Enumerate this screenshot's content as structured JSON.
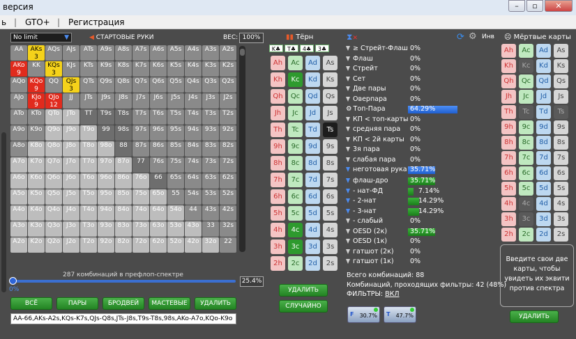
{
  "title": "версия",
  "window_buttons": [
    "–",
    "▫",
    "✕"
  ],
  "menu": [
    "ь",
    "GTO+",
    "Регистрация"
  ],
  "left": {
    "mode": "No limit",
    "start_hands": "СТАРТОВЫЕ РУКИ",
    "weight_label": "ВЕС:",
    "weight": "100%",
    "combos": "287 комбинаций в префлоп-спектре",
    "slider_min": "0%",
    "slider_val": "25.4%",
    "buttons": [
      "ВСЁ",
      "ПАРЫ",
      "БРОДВЕЙ",
      "МАСТЕВЫЕ",
      "УДАЛИТЬ"
    ],
    "range_text": "AA-66,AKs-A2s,KQs-K7s,QJs-Q8s,JTs-J8s,T9s-T8s,98s,AKo-A7o,KQo-K9o",
    "grid": [
      [
        [
          "AA",
          ""
        ],
        [
          "AKs",
          "3"
        ],
        [
          "AQs",
          ""
        ],
        [
          "AJs",
          ""
        ],
        [
          "ATs",
          ""
        ],
        [
          "A9s",
          ""
        ],
        [
          "A8s",
          ""
        ],
        [
          "A7s",
          ""
        ],
        [
          "A6s",
          ""
        ],
        [
          "A5s",
          ""
        ],
        [
          "A4s",
          ""
        ],
        [
          "A3s",
          ""
        ],
        [
          "A2s",
          ""
        ]
      ],
      [
        [
          "AKo",
          "9"
        ],
        [
          "KK",
          ""
        ],
        [
          "KQs",
          "3"
        ],
        [
          "KJs",
          ""
        ],
        [
          "KTs",
          ""
        ],
        [
          "K9s",
          ""
        ],
        [
          "K8s",
          ""
        ],
        [
          "K7s",
          ""
        ],
        [
          "K6s",
          ""
        ],
        [
          "K5s",
          ""
        ],
        [
          "K4s",
          ""
        ],
        [
          "K3s",
          ""
        ],
        [
          "K2s",
          ""
        ]
      ],
      [
        [
          "AQo",
          ""
        ],
        [
          "KQo",
          "9"
        ],
        [
          "QQ",
          ""
        ],
        [
          "QJs",
          "3"
        ],
        [
          "QTs",
          ""
        ],
        [
          "Q9s",
          ""
        ],
        [
          "Q8s",
          ""
        ],
        [
          "Q7s",
          ""
        ],
        [
          "Q6s",
          ""
        ],
        [
          "Q5s",
          ""
        ],
        [
          "Q4s",
          ""
        ],
        [
          "Q3s",
          ""
        ],
        [
          "Q2s",
          ""
        ]
      ],
      [
        [
          "AJo",
          ""
        ],
        [
          "KJo",
          "9"
        ],
        [
          "QJo",
          "12"
        ],
        [
          "JJ",
          ""
        ],
        [
          "JTs",
          ""
        ],
        [
          "J9s",
          ""
        ],
        [
          "J8s",
          ""
        ],
        [
          "J7s",
          ""
        ],
        [
          "J6s",
          ""
        ],
        [
          "J5s",
          ""
        ],
        [
          "J4s",
          ""
        ],
        [
          "J3s",
          ""
        ],
        [
          "J2s",
          ""
        ]
      ],
      [
        [
          "ATo",
          ""
        ],
        [
          "KTo",
          ""
        ],
        [
          "QTo",
          ""
        ],
        [
          "JTo",
          ""
        ],
        [
          "TT",
          ""
        ],
        [
          "T9s",
          ""
        ],
        [
          "T8s",
          ""
        ],
        [
          "T7s",
          ""
        ],
        [
          "T6s",
          ""
        ],
        [
          "T5s",
          ""
        ],
        [
          "T4s",
          ""
        ],
        [
          "T3s",
          ""
        ],
        [
          "T2s",
          ""
        ]
      ],
      [
        [
          "A9o",
          ""
        ],
        [
          "K9o",
          ""
        ],
        [
          "Q9o",
          ""
        ],
        [
          "J9o",
          ""
        ],
        [
          "T9o",
          ""
        ],
        [
          "99",
          ""
        ],
        [
          "98s",
          ""
        ],
        [
          "97s",
          ""
        ],
        [
          "96s",
          ""
        ],
        [
          "95s",
          ""
        ],
        [
          "94s",
          ""
        ],
        [
          "93s",
          ""
        ],
        [
          "92s",
          ""
        ]
      ],
      [
        [
          "A8o",
          ""
        ],
        [
          "K8o",
          ""
        ],
        [
          "Q8o",
          ""
        ],
        [
          "J8o",
          ""
        ],
        [
          "T8o",
          ""
        ],
        [
          "98o",
          ""
        ],
        [
          "88",
          ""
        ],
        [
          "87s",
          ""
        ],
        [
          "86s",
          ""
        ],
        [
          "85s",
          ""
        ],
        [
          "84s",
          ""
        ],
        [
          "83s",
          ""
        ],
        [
          "82s",
          ""
        ]
      ],
      [
        [
          "A7o",
          ""
        ],
        [
          "K7o",
          ""
        ],
        [
          "Q7o",
          ""
        ],
        [
          "J7o",
          ""
        ],
        [
          "T7o",
          ""
        ],
        [
          "97o",
          ""
        ],
        [
          "87o",
          ""
        ],
        [
          "77",
          ""
        ],
        [
          "76s",
          ""
        ],
        [
          "75s",
          ""
        ],
        [
          "74s",
          ""
        ],
        [
          "73s",
          ""
        ],
        [
          "72s",
          ""
        ]
      ],
      [
        [
          "A6o",
          ""
        ],
        [
          "K6o",
          ""
        ],
        [
          "Q6o",
          ""
        ],
        [
          "J6o",
          ""
        ],
        [
          "T6o",
          ""
        ],
        [
          "96o",
          ""
        ],
        [
          "86o",
          ""
        ],
        [
          "76o",
          ""
        ],
        [
          "66",
          ""
        ],
        [
          "65s",
          ""
        ],
        [
          "64s",
          ""
        ],
        [
          "63s",
          ""
        ],
        [
          "62s",
          ""
        ]
      ],
      [
        [
          "A5o",
          ""
        ],
        [
          "K5o",
          ""
        ],
        [
          "Q5o",
          ""
        ],
        [
          "J5o",
          ""
        ],
        [
          "T5o",
          ""
        ],
        [
          "95o",
          ""
        ],
        [
          "85o",
          ""
        ],
        [
          "75o",
          ""
        ],
        [
          "65o",
          ""
        ],
        [
          "55",
          ""
        ],
        [
          "54s",
          ""
        ],
        [
          "53s",
          ""
        ],
        [
          "52s",
          ""
        ]
      ],
      [
        [
          "A4o",
          ""
        ],
        [
          "K4o",
          ""
        ],
        [
          "Q4o",
          ""
        ],
        [
          "J4o",
          ""
        ],
        [
          "T4o",
          ""
        ],
        [
          "94o",
          ""
        ],
        [
          "84o",
          ""
        ],
        [
          "74o",
          ""
        ],
        [
          "64o",
          ""
        ],
        [
          "54o",
          ""
        ],
        [
          "44",
          ""
        ],
        [
          "43s",
          ""
        ],
        [
          "42s",
          ""
        ]
      ],
      [
        [
          "A3o",
          ""
        ],
        [
          "K3o",
          ""
        ],
        [
          "Q3o",
          ""
        ],
        [
          "J3o",
          ""
        ],
        [
          "T3o",
          ""
        ],
        [
          "93o",
          ""
        ],
        [
          "83o",
          ""
        ],
        [
          "73o",
          ""
        ],
        [
          "63o",
          ""
        ],
        [
          "53o",
          ""
        ],
        [
          "43o",
          ""
        ],
        [
          "33",
          ""
        ],
        [
          "32s",
          ""
        ]
      ],
      [
        [
          "A2o",
          ""
        ],
        [
          "K2o",
          ""
        ],
        [
          "Q2o",
          ""
        ],
        [
          "J2o",
          ""
        ],
        [
          "T2o",
          ""
        ],
        [
          "92o",
          ""
        ],
        [
          "82o",
          ""
        ],
        [
          "72o",
          ""
        ],
        [
          "62o",
          ""
        ],
        [
          "52o",
          ""
        ],
        [
          "42o",
          ""
        ],
        [
          "32o",
          ""
        ],
        [
          "22",
          ""
        ]
      ]
    ]
  },
  "board": {
    "title": "Тёрн",
    "cards": [
      "K♣",
      "T♣",
      "4♣",
      "3♣"
    ],
    "ranks": [
      "A",
      "K",
      "Q",
      "J",
      "T",
      "9",
      "8",
      "7",
      "6",
      "5",
      "4",
      "3",
      "2"
    ],
    "suits": [
      "h",
      "c",
      "d",
      "s"
    ],
    "delete": "УДАЛИТЬ",
    "random": "СЛУЧАЙНО"
  },
  "filters": {
    "rows": [
      {
        "name": "≥ Стрейт-Флаш",
        "val": "0%",
        "pct": 0
      },
      {
        "name": "Флаш",
        "val": "0%",
        "pct": 0
      },
      {
        "name": "Стрейт",
        "val": "0%",
        "pct": 0
      },
      {
        "name": "Сет",
        "val": "0%",
        "pct": 0
      },
      {
        "name": "Две пары",
        "val": "0%",
        "pct": 0
      },
      {
        "name": "Оверпара",
        "val": "0%",
        "pct": 0
      },
      {
        "name": "Топ-Пара",
        "val": "64.29%",
        "pct": 64.29
      },
      {
        "name": "КП < топ-карты",
        "val": "0%",
        "pct": 0
      },
      {
        "name": "средняя пара",
        "val": "0%",
        "pct": 0
      },
      {
        "name": "КП < 2й карты",
        "val": "0%",
        "pct": 0
      },
      {
        "name": "3я пара",
        "val": "0%",
        "pct": 0
      },
      {
        "name": "слабая пара",
        "val": "0%",
        "pct": 0
      },
      {
        "name": "неготовая рука",
        "val": "35.71%",
        "pct": 35.71
      }
    ],
    "draws": [
      {
        "name": "флаш-дро",
        "val": "35.71%",
        "pct": 35.71
      },
      {
        "name": "- нат-ФД",
        "val": "7.14%",
        "pct": 7.14
      },
      {
        "name": "- 2-нат",
        "val": "14.29%",
        "pct": 14.29
      },
      {
        "name": "- 3-нат",
        "val": "14.29%",
        "pct": 14.29
      },
      {
        "name": "- слабый",
        "val": "0%",
        "pct": 0
      },
      {
        "name": "OESD (2к)",
        "val": "35.71%",
        "pct": 35.71
      },
      {
        "name": "OESD (1к)",
        "val": "0%",
        "pct": 0
      },
      {
        "name": "гатшот (2к)",
        "val": "0%",
        "pct": 0
      },
      {
        "name": "гатшот (1к)",
        "val": "0%",
        "pct": 0
      }
    ],
    "total": "Всего комбинаций: 88",
    "passing": "Комбинаций, проходящих фильтры: 42 (48%)",
    "filters_label": "ФИЛЬТРЫ:",
    "filters_val": "ВКЛ",
    "mini": [
      "30.7%",
      "47.7%"
    ],
    "inv": "Инв"
  },
  "dead": {
    "title": "Мёртвые карты",
    "message": "Введите свои две карты, чтобы увидеть их эквити против спектра",
    "delete": "УДАЛИТЬ"
  }
}
